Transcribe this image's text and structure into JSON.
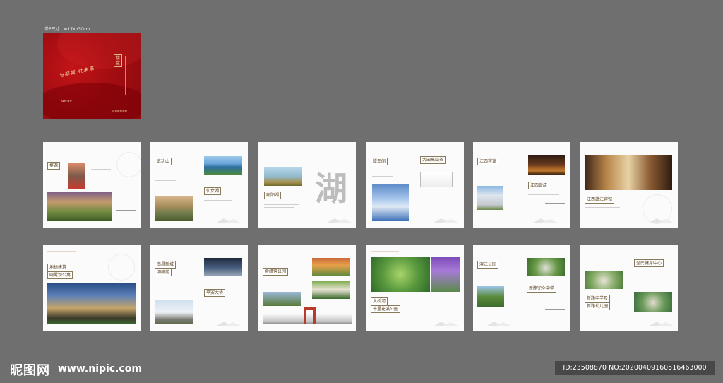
{
  "size_label": "单P尺寸：w17xh30cm",
  "cover": {
    "calligraphy": "与都城 共未来",
    "vertical_title": "楼盘",
    "bottom_text": "项目推荐手册",
    "brand": "保利·置业"
  },
  "pages": [
    {
      "labels": [
        "婺源"
      ]
    },
    {
      "labels": [
        "武功山",
        "仙女湖"
      ]
    },
    {
      "labels": [
        "鄱阳湖"
      ],
      "calligraphy": "湖"
    },
    {
      "labels": [
        "滕王阁",
        "大田高山茶"
      ]
    },
    {
      "labels": [
        "江西宾馆",
        "江西饭店"
      ]
    },
    {
      "labels": [
        "江西赣江宾馆"
      ]
    },
    {
      "labels": [
        "地标建筑",
        "鸥鹭观公寓"
      ]
    },
    {
      "labels": [
        "南昌新城",
        "明楠苑",
        "平安大桥"
      ]
    },
    {
      "labels": [
        "金峰营公园"
      ]
    },
    {
      "labels": [
        "大桥河",
        "十里花溪公园"
      ]
    },
    {
      "labels": [
        "滨江公园",
        "新路完全中学"
      ]
    },
    {
      "labels": [
        "全民健身中心",
        "新路中学及",
        "新路幼儿园"
      ]
    }
  ],
  "watermark": {
    "logo": "昵图网",
    "url": "www.nipic.com",
    "id_text": "ID:23508870 NO:20200409160516463000"
  },
  "colors": {
    "background": "#6f6f6f",
    "cover_red": "#a30d12",
    "gold": "#d9b97a",
    "label_border": "#8a7a5c"
  }
}
